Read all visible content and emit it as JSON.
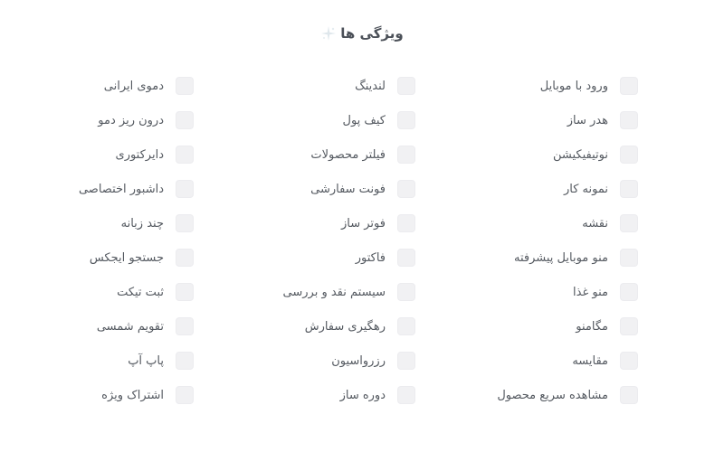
{
  "section": {
    "title": "ویژگی ها",
    "title_icon": "sparkle-icon"
  },
  "columns": [
    {
      "items": [
        {
          "label": "ورود با موبایل",
          "checked": false
        },
        {
          "label": "هدر ساز",
          "checked": false
        },
        {
          "label": "نوتیفیکیشن",
          "checked": false
        },
        {
          "label": "نمونه کار",
          "checked": false
        },
        {
          "label": "نقشه",
          "checked": false
        },
        {
          "label": "منو موبایل پیشرفته",
          "checked": false
        },
        {
          "label": "منو غذا",
          "checked": false
        },
        {
          "label": "مگامنو",
          "checked": false
        },
        {
          "label": "مقایسه",
          "checked": false
        },
        {
          "label": "مشاهده سریع محصول",
          "checked": false
        }
      ]
    },
    {
      "items": [
        {
          "label": "لندینگ",
          "checked": false
        },
        {
          "label": "کیف پول",
          "checked": false
        },
        {
          "label": "فیلتر محصولات",
          "checked": false
        },
        {
          "label": "فونت سفارشی",
          "checked": false
        },
        {
          "label": "فوتر ساز",
          "checked": false
        },
        {
          "label": "فاکتور",
          "checked": false
        },
        {
          "label": "سیستم نقد و بررسی",
          "checked": false
        },
        {
          "label": "رهگیری سفارش",
          "checked": false
        },
        {
          "label": "رزرواسیون",
          "checked": false
        },
        {
          "label": "دوره ساز",
          "checked": false
        }
      ]
    },
    {
      "items": [
        {
          "label": "دموی ایرانی",
          "checked": false
        },
        {
          "label": "درون ریز دمو",
          "checked": false
        },
        {
          "label": "دایرکتوری",
          "checked": false
        },
        {
          "label": "داشبور اختصاصی",
          "checked": false
        },
        {
          "label": "چند زبانه",
          "checked": false
        },
        {
          "label": "جستجو ایجکس",
          "checked": false
        },
        {
          "label": "ثبت تیکت",
          "checked": false
        },
        {
          "label": "تقویم شمسی",
          "checked": false
        },
        {
          "label": "پاپ آپ",
          "checked": false
        },
        {
          "label": "اشتراک ویژه",
          "checked": false
        }
      ]
    }
  ],
  "colors": {
    "checkbox_bg": "#f1f1f3",
    "text": "#555a61"
  }
}
